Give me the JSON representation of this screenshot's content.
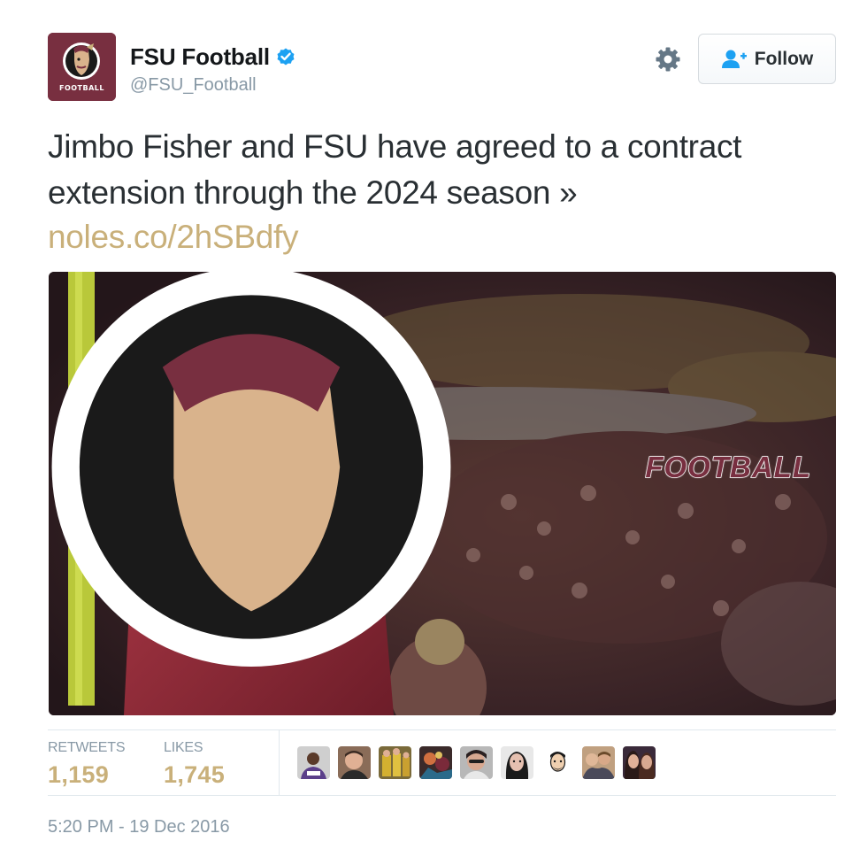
{
  "account": {
    "name": "FSU Football",
    "handle": "@FSU_Football",
    "avatar_icon": "seminole-head-logo",
    "avatar_caption": "FOOTBALL",
    "verified_icon": "verified-badge-icon"
  },
  "actions": {
    "settings_icon": "gear-icon",
    "follow_label": "Follow",
    "follow_icon": "add-user-icon"
  },
  "tweet": {
    "text": "Jimbo Fisher and FSU have agreed to a contract extension through the 2024 season »",
    "link": "noles.co/2hSBdfy",
    "media_watermark": "FOOTBALL"
  },
  "stats": {
    "retweets_label": "RETWEETS",
    "retweets_value": "1,159",
    "likes_label": "LIKES",
    "likes_value": "1,745"
  },
  "likers_count_shown": 9,
  "timestamp": "5:20 PM - 19 Dec 2016",
  "colors": {
    "brand_garnet": "#782f40",
    "brand_gold": "#c9b07a",
    "text": "#292f33",
    "muted": "#8899a6",
    "verified_blue": "#1da1f2"
  }
}
